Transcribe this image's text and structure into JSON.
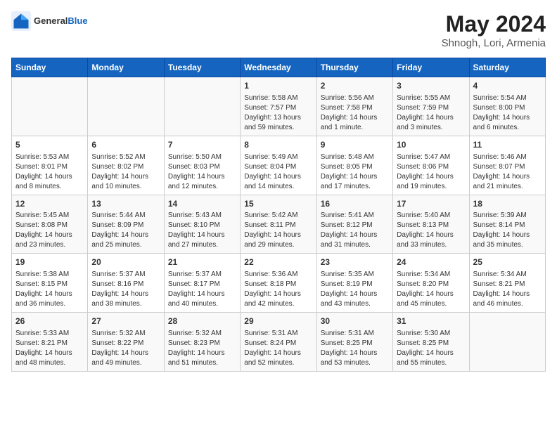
{
  "header": {
    "logo_general": "General",
    "logo_blue": "Blue",
    "title": "May 2024",
    "subtitle": "Shnogh, Lori, Armenia"
  },
  "weekdays": [
    "Sunday",
    "Monday",
    "Tuesday",
    "Wednesday",
    "Thursday",
    "Friday",
    "Saturday"
  ],
  "weeks": [
    [
      {
        "day": "",
        "info": ""
      },
      {
        "day": "",
        "info": ""
      },
      {
        "day": "",
        "info": ""
      },
      {
        "day": "1",
        "info": "Sunrise: 5:58 AM\nSunset: 7:57 PM\nDaylight: 13 hours and 59 minutes."
      },
      {
        "day": "2",
        "info": "Sunrise: 5:56 AM\nSunset: 7:58 PM\nDaylight: 14 hours and 1 minute."
      },
      {
        "day": "3",
        "info": "Sunrise: 5:55 AM\nSunset: 7:59 PM\nDaylight: 14 hours and 3 minutes."
      },
      {
        "day": "4",
        "info": "Sunrise: 5:54 AM\nSunset: 8:00 PM\nDaylight: 14 hours and 6 minutes."
      }
    ],
    [
      {
        "day": "5",
        "info": "Sunrise: 5:53 AM\nSunset: 8:01 PM\nDaylight: 14 hours and 8 minutes."
      },
      {
        "day": "6",
        "info": "Sunrise: 5:52 AM\nSunset: 8:02 PM\nDaylight: 14 hours and 10 minutes."
      },
      {
        "day": "7",
        "info": "Sunrise: 5:50 AM\nSunset: 8:03 PM\nDaylight: 14 hours and 12 minutes."
      },
      {
        "day": "8",
        "info": "Sunrise: 5:49 AM\nSunset: 8:04 PM\nDaylight: 14 hours and 14 minutes."
      },
      {
        "day": "9",
        "info": "Sunrise: 5:48 AM\nSunset: 8:05 PM\nDaylight: 14 hours and 17 minutes."
      },
      {
        "day": "10",
        "info": "Sunrise: 5:47 AM\nSunset: 8:06 PM\nDaylight: 14 hours and 19 minutes."
      },
      {
        "day": "11",
        "info": "Sunrise: 5:46 AM\nSunset: 8:07 PM\nDaylight: 14 hours and 21 minutes."
      }
    ],
    [
      {
        "day": "12",
        "info": "Sunrise: 5:45 AM\nSunset: 8:08 PM\nDaylight: 14 hours and 23 minutes."
      },
      {
        "day": "13",
        "info": "Sunrise: 5:44 AM\nSunset: 8:09 PM\nDaylight: 14 hours and 25 minutes."
      },
      {
        "day": "14",
        "info": "Sunrise: 5:43 AM\nSunset: 8:10 PM\nDaylight: 14 hours and 27 minutes."
      },
      {
        "day": "15",
        "info": "Sunrise: 5:42 AM\nSunset: 8:11 PM\nDaylight: 14 hours and 29 minutes."
      },
      {
        "day": "16",
        "info": "Sunrise: 5:41 AM\nSunset: 8:12 PM\nDaylight: 14 hours and 31 minutes."
      },
      {
        "day": "17",
        "info": "Sunrise: 5:40 AM\nSunset: 8:13 PM\nDaylight: 14 hours and 33 minutes."
      },
      {
        "day": "18",
        "info": "Sunrise: 5:39 AM\nSunset: 8:14 PM\nDaylight: 14 hours and 35 minutes."
      }
    ],
    [
      {
        "day": "19",
        "info": "Sunrise: 5:38 AM\nSunset: 8:15 PM\nDaylight: 14 hours and 36 minutes."
      },
      {
        "day": "20",
        "info": "Sunrise: 5:37 AM\nSunset: 8:16 PM\nDaylight: 14 hours and 38 minutes."
      },
      {
        "day": "21",
        "info": "Sunrise: 5:37 AM\nSunset: 8:17 PM\nDaylight: 14 hours and 40 minutes."
      },
      {
        "day": "22",
        "info": "Sunrise: 5:36 AM\nSunset: 8:18 PM\nDaylight: 14 hours and 42 minutes."
      },
      {
        "day": "23",
        "info": "Sunrise: 5:35 AM\nSunset: 8:19 PM\nDaylight: 14 hours and 43 minutes."
      },
      {
        "day": "24",
        "info": "Sunrise: 5:34 AM\nSunset: 8:20 PM\nDaylight: 14 hours and 45 minutes."
      },
      {
        "day": "25",
        "info": "Sunrise: 5:34 AM\nSunset: 8:21 PM\nDaylight: 14 hours and 46 minutes."
      }
    ],
    [
      {
        "day": "26",
        "info": "Sunrise: 5:33 AM\nSunset: 8:21 PM\nDaylight: 14 hours and 48 minutes."
      },
      {
        "day": "27",
        "info": "Sunrise: 5:32 AM\nSunset: 8:22 PM\nDaylight: 14 hours and 49 minutes."
      },
      {
        "day": "28",
        "info": "Sunrise: 5:32 AM\nSunset: 8:23 PM\nDaylight: 14 hours and 51 minutes."
      },
      {
        "day": "29",
        "info": "Sunrise: 5:31 AM\nSunset: 8:24 PM\nDaylight: 14 hours and 52 minutes."
      },
      {
        "day": "30",
        "info": "Sunrise: 5:31 AM\nSunset: 8:25 PM\nDaylight: 14 hours and 53 minutes."
      },
      {
        "day": "31",
        "info": "Sunrise: 5:30 AM\nSunset: 8:25 PM\nDaylight: 14 hours and 55 minutes."
      },
      {
        "day": "",
        "info": ""
      }
    ]
  ]
}
